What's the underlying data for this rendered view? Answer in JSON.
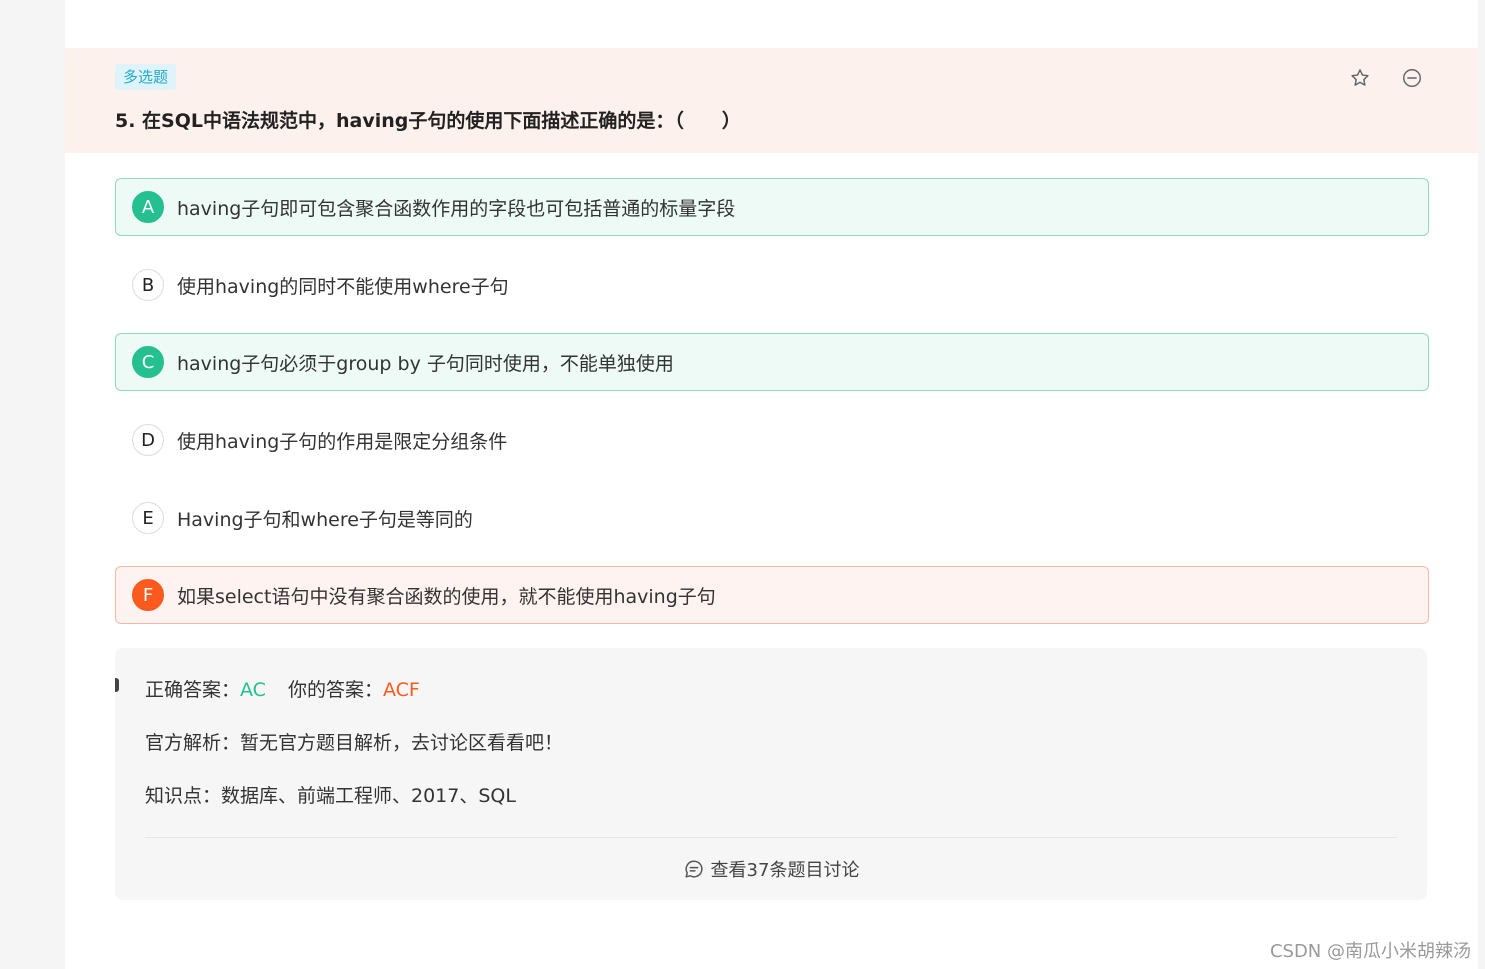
{
  "question": {
    "type_tag": "多选题",
    "title": "5. 在SQL中语法规范中，having子句的使用下面描述正确的是：（　　）"
  },
  "options": [
    {
      "letter": "A",
      "text": "having子句即可包含聚合函数作用的字段也可包括普通的标量字段",
      "state": "correct"
    },
    {
      "letter": "B",
      "text": "使用having的同时不能使用where子句",
      "state": "normal"
    },
    {
      "letter": "C",
      "text": "having子句必须于group by 子句同时使用，不能单独使用",
      "state": "correct"
    },
    {
      "letter": "D",
      "text": "使用having子句的作用是限定分组条件",
      "state": "normal"
    },
    {
      "letter": "E",
      "text": "Having子句和where子句是等同的",
      "state": "normal"
    },
    {
      "letter": "F",
      "text": "如果select语句中没有聚合函数的使用，就不能使用having子句",
      "state": "wrong"
    }
  ],
  "analysis": {
    "correct_label": "正确答案：",
    "correct_value": "AC",
    "yours_label": "你的答案：",
    "yours_value": "ACF",
    "explanation": "官方解析：暂无官方题目解析，去讨论区看看吧！",
    "knowledge": "知识点：数据库、前端工程师、2017、SQL",
    "discuss_link": "查看37条题目讨论"
  },
  "watermark": "CSDN @南瓜小米胡辣汤",
  "colors": {
    "correct": "#25c08f",
    "wrong": "#fa5a1e",
    "header_bg": "#fdf1ee",
    "tag_bg": "#dff4fa",
    "tag_text": "#25a9c8"
  },
  "icons": [
    "star-icon",
    "minus-circle-icon",
    "chat-bubble-icon"
  ]
}
